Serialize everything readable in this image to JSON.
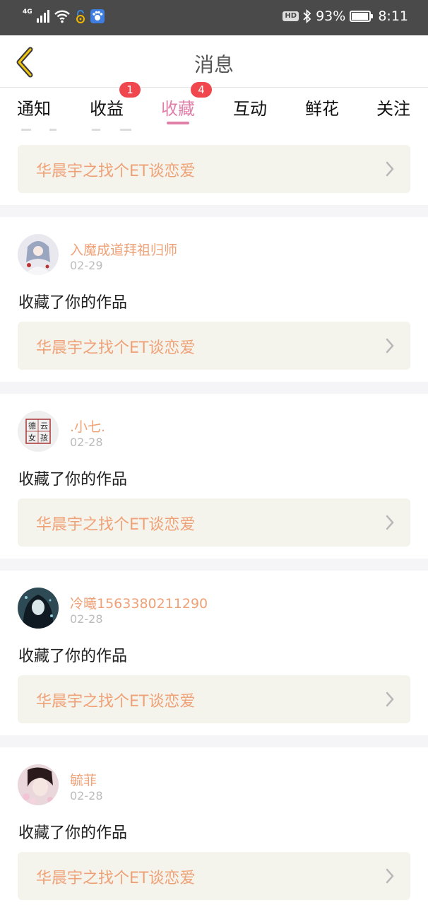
{
  "status_bar": {
    "network": "4G",
    "hd": "HD",
    "battery_percent": "93%",
    "battery_level": 0.93,
    "time": "8:11"
  },
  "header": {
    "title": "消息",
    "back_icon": "chevron-left-icon"
  },
  "tabs": [
    {
      "label": "通知",
      "badge": ""
    },
    {
      "label": "收益",
      "badge": "1"
    },
    {
      "label": "收藏",
      "badge": "4",
      "active": true
    },
    {
      "label": "互动",
      "badge": ""
    },
    {
      "label": "鲜花",
      "badge": ""
    },
    {
      "label": "关注",
      "badge": ""
    }
  ],
  "colors": {
    "accent_pink": "#e080a8",
    "badge_red": "#f0464e",
    "name_orange": "#efa177",
    "card_bg": "#f5f4ec"
  },
  "top_card": {
    "work_title": "华晨宇之找个ET谈恋爱"
  },
  "items": [
    {
      "user": "入魔成道拜祖归师",
      "date": "02-29",
      "action": "收藏了你的作品",
      "work_title": "华晨宇之找个ET谈恋爱"
    },
    {
      "user": ".小七.",
      "date": "02-28",
      "action": "收藏了你的作品",
      "work_title": "华晨宇之找个ET谈恋爱",
      "avatar_text": [
        "德",
        "云",
        "女",
        "孩"
      ]
    },
    {
      "user": "冷曦1563380211290",
      "date": "02-28",
      "action": "收藏了你的作品",
      "work_title": "华晨宇之找个ET谈恋爱"
    },
    {
      "user": "毓菲",
      "date": "02-28",
      "action": "收藏了你的作品",
      "work_title": "华晨宇之找个ET谈恋爱"
    }
  ]
}
